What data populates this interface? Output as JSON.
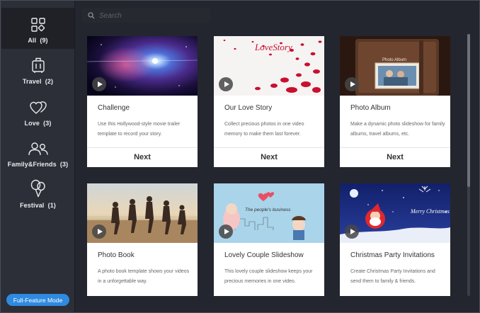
{
  "search": {
    "placeholder": "Search"
  },
  "sidebar": {
    "items": [
      {
        "label": "All",
        "count": "(9)",
        "icon": "grid-icon"
      },
      {
        "label": "Travel",
        "count": "(2)",
        "icon": "luggage-icon"
      },
      {
        "label": "Love",
        "count": "(3)",
        "icon": "hearts-icon"
      },
      {
        "label": "Family&Friends",
        "count": "(3)",
        "icon": "people-icon"
      },
      {
        "label": "Festival",
        "count": "(1)",
        "icon": "balloons-icon"
      }
    ],
    "full_feature_label": "Full-Feature Mode"
  },
  "templates": [
    {
      "title": "Challenge",
      "desc": "Use this Hollywood-style movie trailer template to record your story.",
      "next": "Next"
    },
    {
      "title": "Our Love Story",
      "desc": "Collect precious photos in one video memory to make them last forever.",
      "next": "Next",
      "thumb_text": "LoveStory"
    },
    {
      "title": "Photo Album",
      "desc": "Make a dynamic photo slideshow for family albums, travel albums, etc.",
      "next": "Next",
      "thumb_text": "Photo Album"
    },
    {
      "title": "Photo Book",
      "desc": "A photo book template shows your videos in a unforgettable way."
    },
    {
      "title": "Lovely Couple Slideshow",
      "desc": "This lovely couple slideshow keeps your precious memories in one video.",
      "thumb_text": "The people's business"
    },
    {
      "title": "Christmas Party Invitations",
      "desc": "Create Christmas Party Invitations and send them to family & friends.",
      "thumb_text": "Merry Christmas"
    }
  ],
  "colors": {
    "background": "#23262e",
    "sidebar": "#2c2f37",
    "accent": "#2f8ae0",
    "card": "#ffffff"
  }
}
